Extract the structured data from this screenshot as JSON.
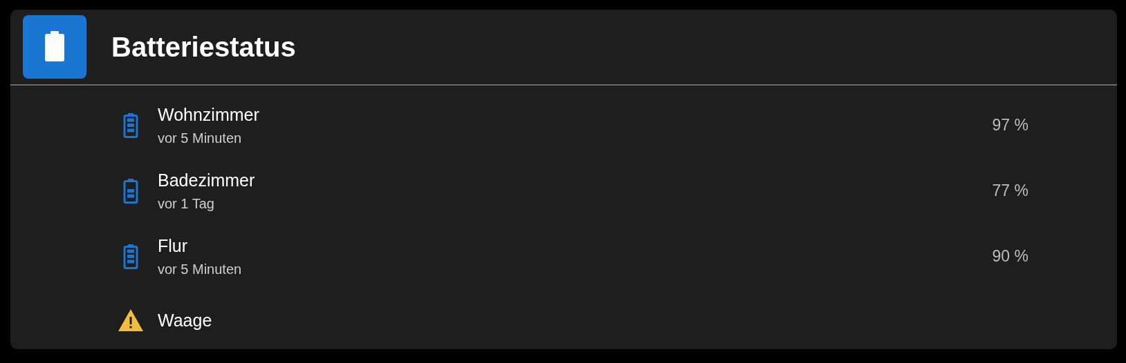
{
  "card": {
    "title": "Batteriestatus",
    "rows": [
      {
        "kind": "battery_high",
        "name": "Wohnzimmer",
        "secondary": "vor 5 Minuten",
        "reading": "97 %"
      },
      {
        "kind": "battery_medium",
        "name": "Badezimmer",
        "secondary": "vor 1 Tag",
        "reading": "77 %"
      },
      {
        "kind": "battery_high",
        "name": "Flur",
        "secondary": "vor 5 Minuten",
        "reading": "90 %"
      },
      {
        "kind": "warning",
        "name": "Waage"
      }
    ]
  }
}
